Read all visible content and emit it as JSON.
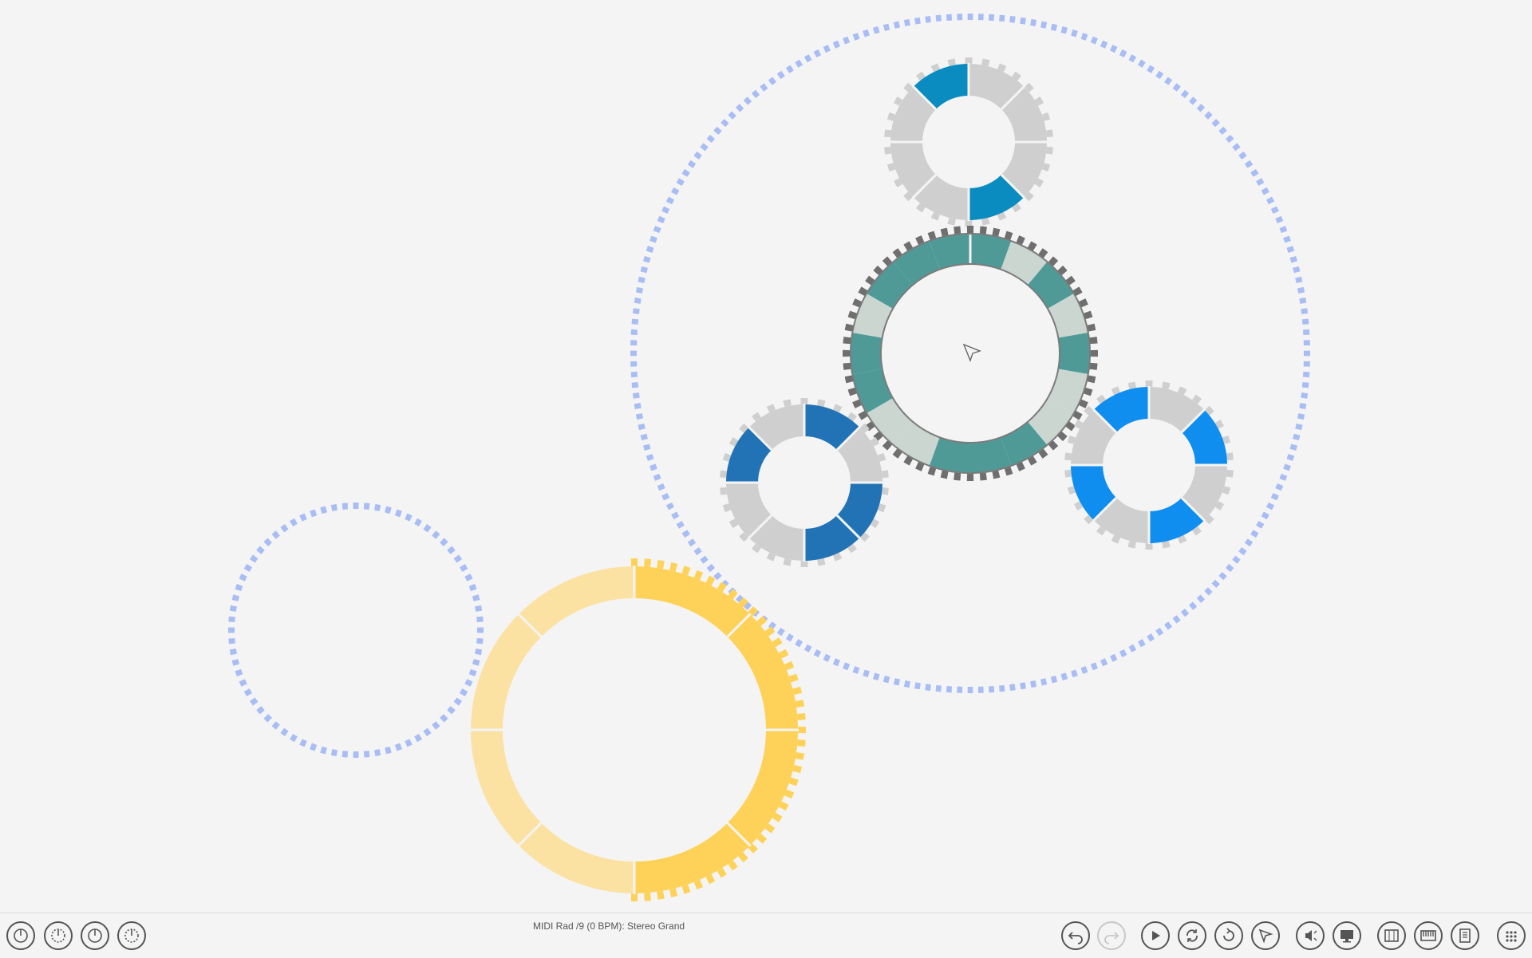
{
  "status": {
    "text": "MIDI Rad /9 (0 BPM): Stereo Grand"
  },
  "colors": {
    "background": "#f4f4f4",
    "outer_ring": "#ff5a26",
    "teeth_blue": "#a9bdf5",
    "teal": "#4f9a97",
    "teal_light": "#cad6cf",
    "gear_grey": "#cfcfcf",
    "blue_dark": "#2273b5",
    "blue_cyan": "#0a8cc0",
    "blue_bright": "#0f8ef0",
    "olive": "#c8d21e",
    "yellow": "#fed258",
    "yellow_light": "#fbe2a3"
  },
  "left_toolbar": [
    {
      "name": "power-knob-1-button",
      "icon": "power-knob-icon"
    },
    {
      "name": "power-knob-2-button",
      "icon": "dial-knob-icon"
    },
    {
      "name": "power-knob-3-button",
      "icon": "power-knob-icon"
    },
    {
      "name": "power-knob-4-button",
      "icon": "dial-knob-icon"
    }
  ],
  "right_toolbar": [
    {
      "name": "undo-button",
      "icon": "undo-icon",
      "enabled": true
    },
    {
      "name": "redo-button",
      "icon": "redo-icon",
      "enabled": false
    },
    {
      "name": "play-button",
      "icon": "play-icon",
      "enabled": true
    },
    {
      "name": "loop-button",
      "icon": "loop-icon",
      "enabled": true
    },
    {
      "name": "redo-rotate-button",
      "icon": "rotate-icon",
      "enabled": true
    },
    {
      "name": "select-tool-button",
      "icon": "pointer-icon",
      "enabled": true
    },
    {
      "name": "speaker-button",
      "icon": "speaker-icon",
      "enabled": true
    },
    {
      "name": "screen-button",
      "icon": "monitor-icon",
      "enabled": true
    },
    {
      "name": "piano-button",
      "icon": "piano-icon",
      "enabled": true
    },
    {
      "name": "keyboard-button",
      "icon": "keyboard-icon",
      "enabled": true
    },
    {
      "name": "notes-button",
      "icon": "document-icon",
      "enabled": true
    },
    {
      "name": "menu-dots-button",
      "icon": "dots-grid-icon",
      "enabled": true
    }
  ]
}
